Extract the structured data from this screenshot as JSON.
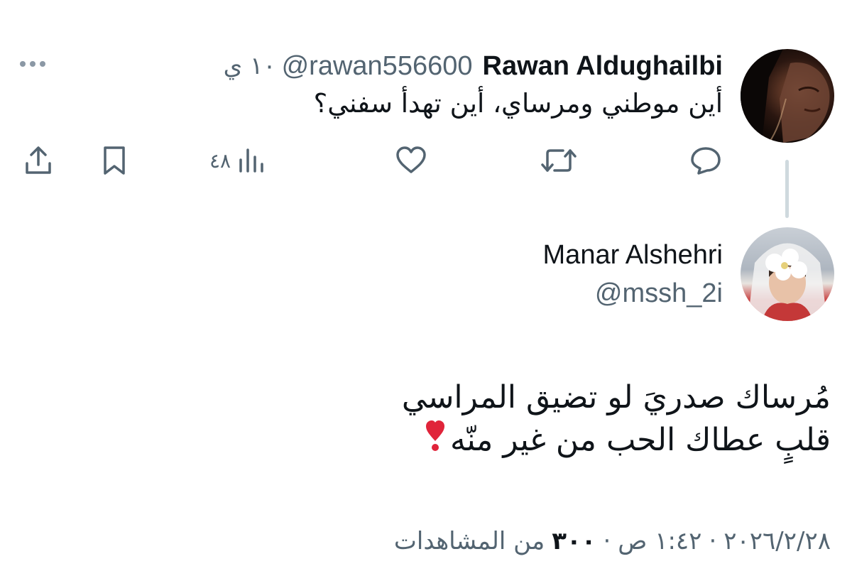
{
  "parent_tweet": {
    "author_name": "Rawan Aldughailbi",
    "author_handle": "@rawan556600",
    "time": "١٠ ي",
    "text": "أين موطني ومرساي، أين تهدأ سفني؟",
    "views_count": "٤٨",
    "icons": [
      "reply-icon",
      "retweet-icon",
      "like-icon",
      "views-icon",
      "bookmark-icon",
      "share-icon",
      "more-icon"
    ]
  },
  "main_tweet": {
    "author_name": "Manar Alshehri",
    "author_handle": "@mssh_2i",
    "text_lines": [
      "مُرساك صدريَ لو تضيق المراسي",
      "قلبٍ عطاك الحب من غير منّه"
    ],
    "emoji": "heart-exclamation-emoji",
    "date": "٢٠٢٦/٢/٢٨",
    "separator": "·",
    "time": "١:٤٢ ص",
    "views_number": "٣٠٠",
    "views_label": "من المشاهدات"
  },
  "colors": {
    "text": "#0f1419",
    "secondary": "#536471",
    "thread_line": "#cfd9de",
    "emoji_red": "#e0243a"
  }
}
